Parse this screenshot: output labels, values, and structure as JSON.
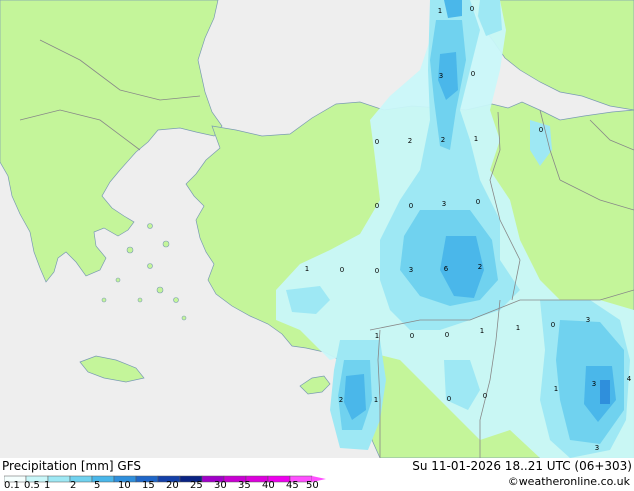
{
  "title": "Precipitation [mm]",
  "model": "GFS",
  "valid_time": "Su 11-01-2026 18..21 UTC (06+303)",
  "credit": "©weatheronline.co.uk",
  "legend": {
    "labels": [
      "0.1",
      "0.5",
      "1",
      "2",
      "5",
      "10",
      "15",
      "20",
      "25",
      "30",
      "35",
      "40",
      "45",
      "50"
    ],
    "colors": [
      "#f5fffe",
      "#c9f7f9",
      "#9ee8f4",
      "#70d2ef",
      "#4ab7ea",
      "#2f8fdc",
      "#1f66c8",
      "#1440a8",
      "#0a2383",
      "#a000c8",
      "#c800d2",
      "#dc00dc",
      "#ee00ee",
      "#ff50ff"
    ]
  },
  "colors": {
    "sea": "#eeeeee",
    "land": "#c4f59a",
    "border": "#888888",
    "coast": "#7a9bb3"
  },
  "map_values": [
    "1",
    "0",
    "3",
    "0",
    "0",
    "2",
    "2",
    "1",
    "0",
    "0",
    "0",
    "3",
    "0",
    "1",
    "0",
    "0",
    "3",
    "6",
    "2",
    "1",
    "0",
    "0",
    "1",
    "1",
    "0",
    "3",
    "2",
    "1",
    "0",
    "0",
    "1",
    "3",
    "4",
    "3"
  ]
}
